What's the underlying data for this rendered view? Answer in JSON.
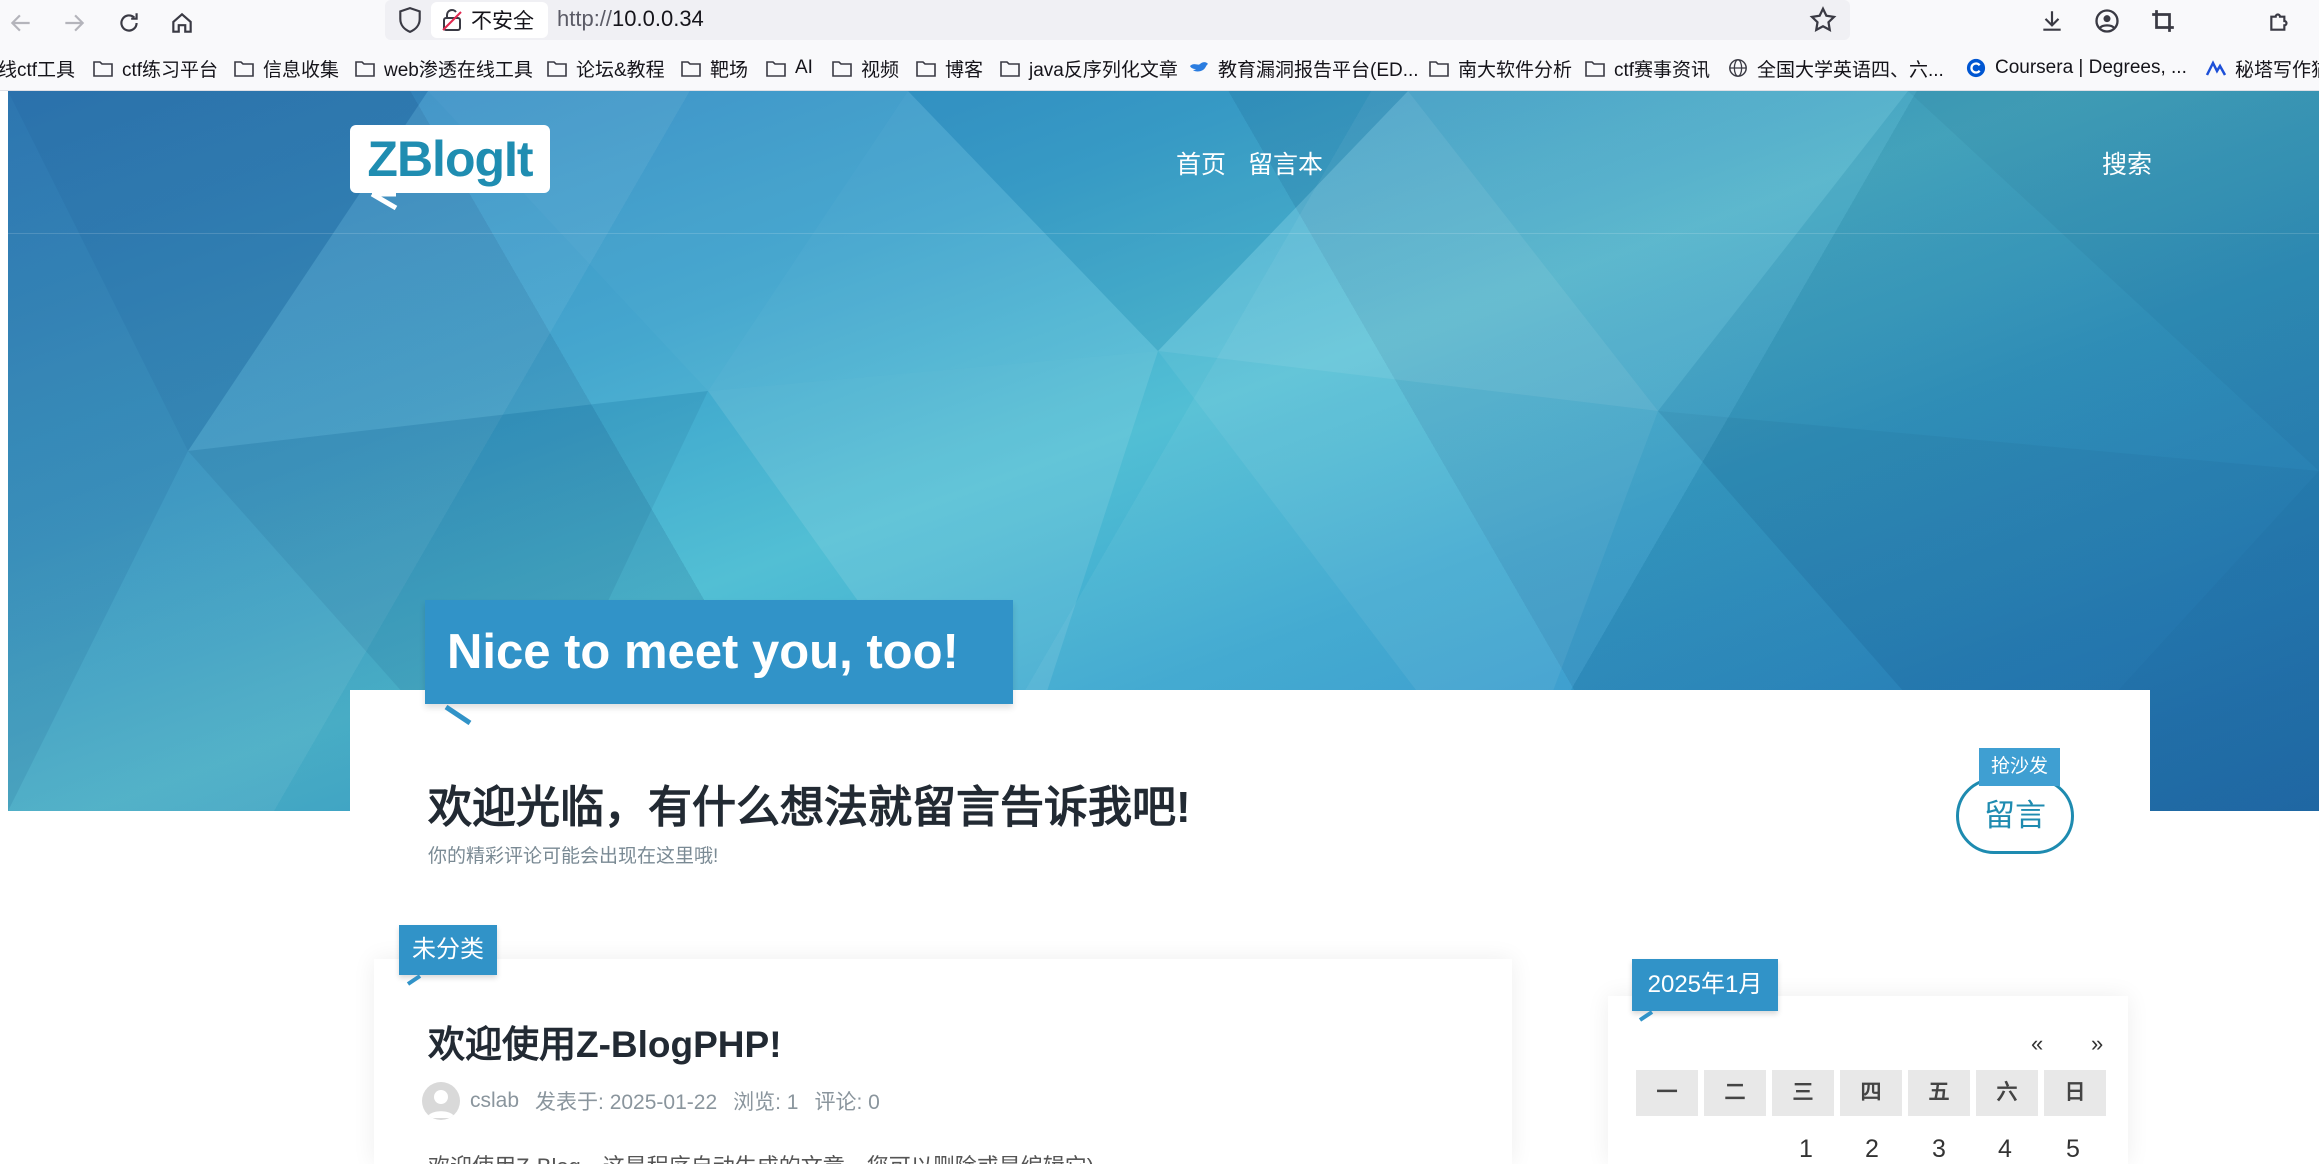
{
  "browser": {
    "insecure_label": "不安全",
    "url_scheme": "http://",
    "url_host": "10.0.0.34"
  },
  "bookmarks": [
    {
      "label": "线ctf工具",
      "icon": "none"
    },
    {
      "label": "ctf练习平台",
      "icon": "folder-icon"
    },
    {
      "label": "信息收集",
      "icon": "folder-icon"
    },
    {
      "label": "web渗透在线工具",
      "icon": "folder-icon"
    },
    {
      "label": "论坛&教程",
      "icon": "folder-icon"
    },
    {
      "label": "靶场",
      "icon": "folder-icon"
    },
    {
      "label": "AI",
      "icon": "folder-icon"
    },
    {
      "label": "视频",
      "icon": "folder-icon"
    },
    {
      "label": "博客",
      "icon": "folder-icon"
    },
    {
      "label": "java反序列化文章",
      "icon": "folder-icon"
    },
    {
      "label": "教育漏洞报告平台(ED...",
      "icon": "bird-icon"
    },
    {
      "label": "南大软件分析",
      "icon": "folder-icon"
    },
    {
      "label": "ctf赛事资讯",
      "icon": "folder-icon"
    },
    {
      "label": "全国大学英语四、六...",
      "icon": "globe-icon"
    },
    {
      "label": "Coursera | Degrees, ...",
      "icon": "coursera-icon"
    },
    {
      "label": "秘塔写作猫",
      "icon": "metaso-icon"
    }
  ],
  "site": {
    "logo": "ZBlogIt",
    "nav": [
      "首页",
      "留言本"
    ],
    "search": "搜索",
    "greeting": "Nice to meet you, too!",
    "welcome_title": "欢迎光临，有什么想法就留言告诉我吧!",
    "welcome_sub": "你的精彩评论可能会出现在这里哦!",
    "sofa_tag": "抢沙发",
    "message_button": "留言"
  },
  "post": {
    "category": "未分类",
    "title": "欢迎使用Z-BlogPHP!",
    "author": "cslab",
    "published": "发表于: 2025-01-22",
    "views": "浏览: 1",
    "comments": "评论: 0",
    "excerpt": "欢迎使用Z-Blog，这是程序自动生成的文章，您可以删除或是编辑它)"
  },
  "calendar": {
    "title": "2025年1月",
    "prev": "«",
    "next": "»",
    "weekdays": [
      "一",
      "二",
      "三",
      "四",
      "五",
      "六",
      "日"
    ],
    "first_row": [
      "1",
      "2",
      "3",
      "4",
      "5"
    ]
  },
  "colors": {
    "accent": "#3193c8",
    "logo_text": "#1f8db1"
  }
}
